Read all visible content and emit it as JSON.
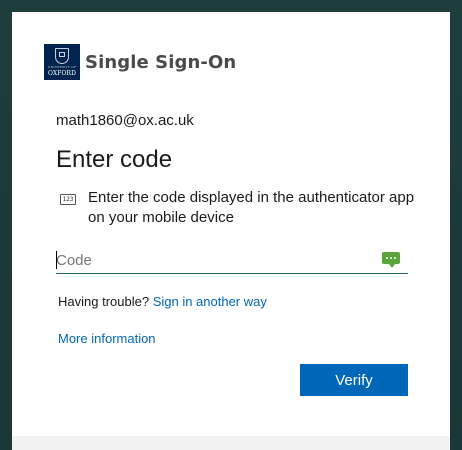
{
  "brand": {
    "crest_line1": "UNIVERSITY OF",
    "crest_line2": "OXFORD",
    "title": "Single Sign-On"
  },
  "identity": {
    "email": "math1860@ox.ac.uk"
  },
  "page": {
    "title": "Enter code"
  },
  "description": {
    "icon_text": "123",
    "text": "Enter the code displayed in the authenticator app on your mobile device"
  },
  "code_input": {
    "value": "",
    "placeholder": "Code"
  },
  "help": {
    "trouble_label": "Having trouble?",
    "alt_link": "Sign in another way",
    "more_info": "More information"
  },
  "actions": {
    "verify_label": "Verify"
  },
  "colors": {
    "accent": "#0067b8",
    "crest_bg": "#00244e",
    "input_underline": "#1f6b62",
    "keyboard_icon": "#5aa53d",
    "backdrop": "#1c3a3a"
  }
}
